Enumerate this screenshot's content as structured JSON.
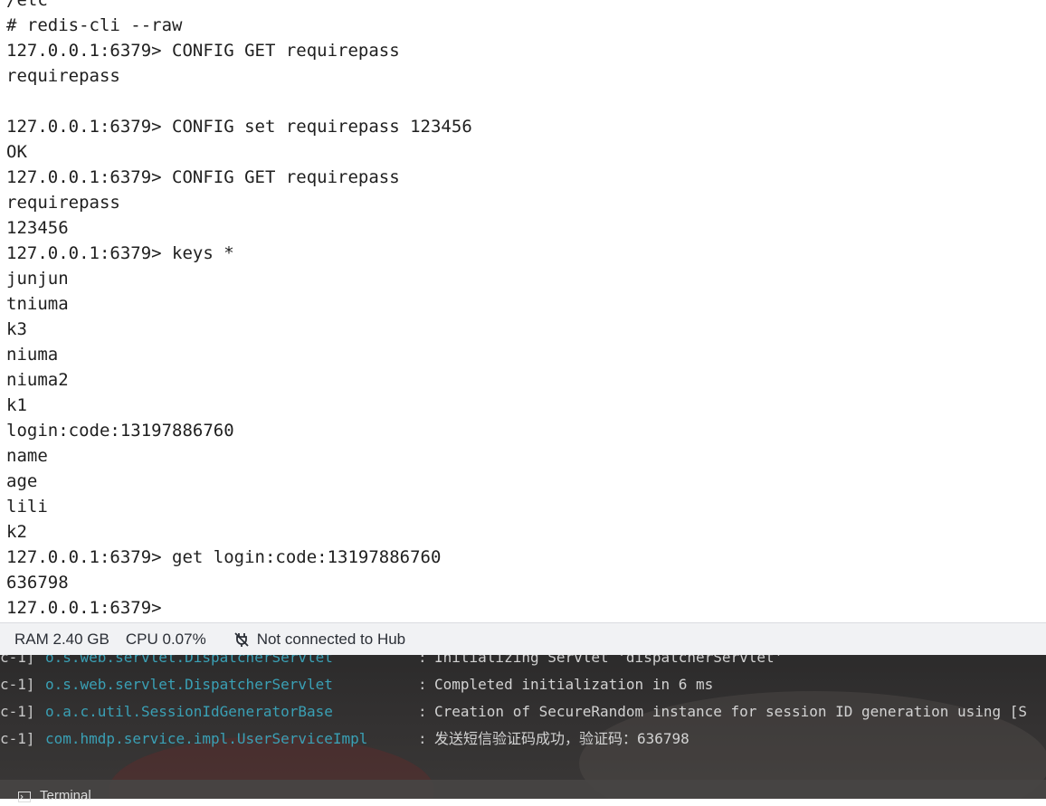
{
  "terminal": {
    "lines": [
      "/etc",
      "# redis-cli --raw",
      "127.0.0.1:6379> CONFIG GET requirepass",
      "requirepass",
      "",
      "127.0.0.1:6379> CONFIG set requirepass 123456",
      "OK",
      "127.0.0.1:6379> CONFIG GET requirepass",
      "requirepass",
      "123456",
      "127.0.0.1:6379> keys *",
      "junjun",
      "tniuma",
      "k3",
      "niuma",
      "niuma2",
      "k1",
      "login:code:13197886760",
      "name",
      "age",
      "lili",
      "k2",
      "127.0.0.1:6379> get login:code:13197886760",
      "636798",
      "127.0.0.1:6379> "
    ]
  },
  "statusbar": {
    "ram": "RAM 2.40 GB",
    "cpu": "CPU 0.07%",
    "hub_status": "Not connected to Hub",
    "hub_icon": "plug-disconnected-icon"
  },
  "log": {
    "entries": [
      {
        "prefix": "c-1]",
        "class": "o.s.web.servlet.DispatcherServlet",
        "message": "Initializing Servlet 'dispatcherServlet'"
      },
      {
        "prefix": "c-1]",
        "class": "o.s.web.servlet.DispatcherServlet",
        "message": "Completed initialization in 6 ms"
      },
      {
        "prefix": "c-1]",
        "class": "o.a.c.util.SessionIdGeneratorBase",
        "message": "Creation of SecureRandom instance for session ID generation using [S"
      },
      {
        "prefix": "c-1]",
        "class": "com.hmdp.service.impl.UserServiceImpl",
        "message": "发送短信验证码成功，验证码：636798"
      }
    ],
    "separator": ":"
  },
  "tool_tab": {
    "label": "Terminal",
    "icon": "terminal-icon"
  },
  "colors": {
    "log_class": "#3aa0b5",
    "statusbar_bg": "#f1f2f4"
  }
}
